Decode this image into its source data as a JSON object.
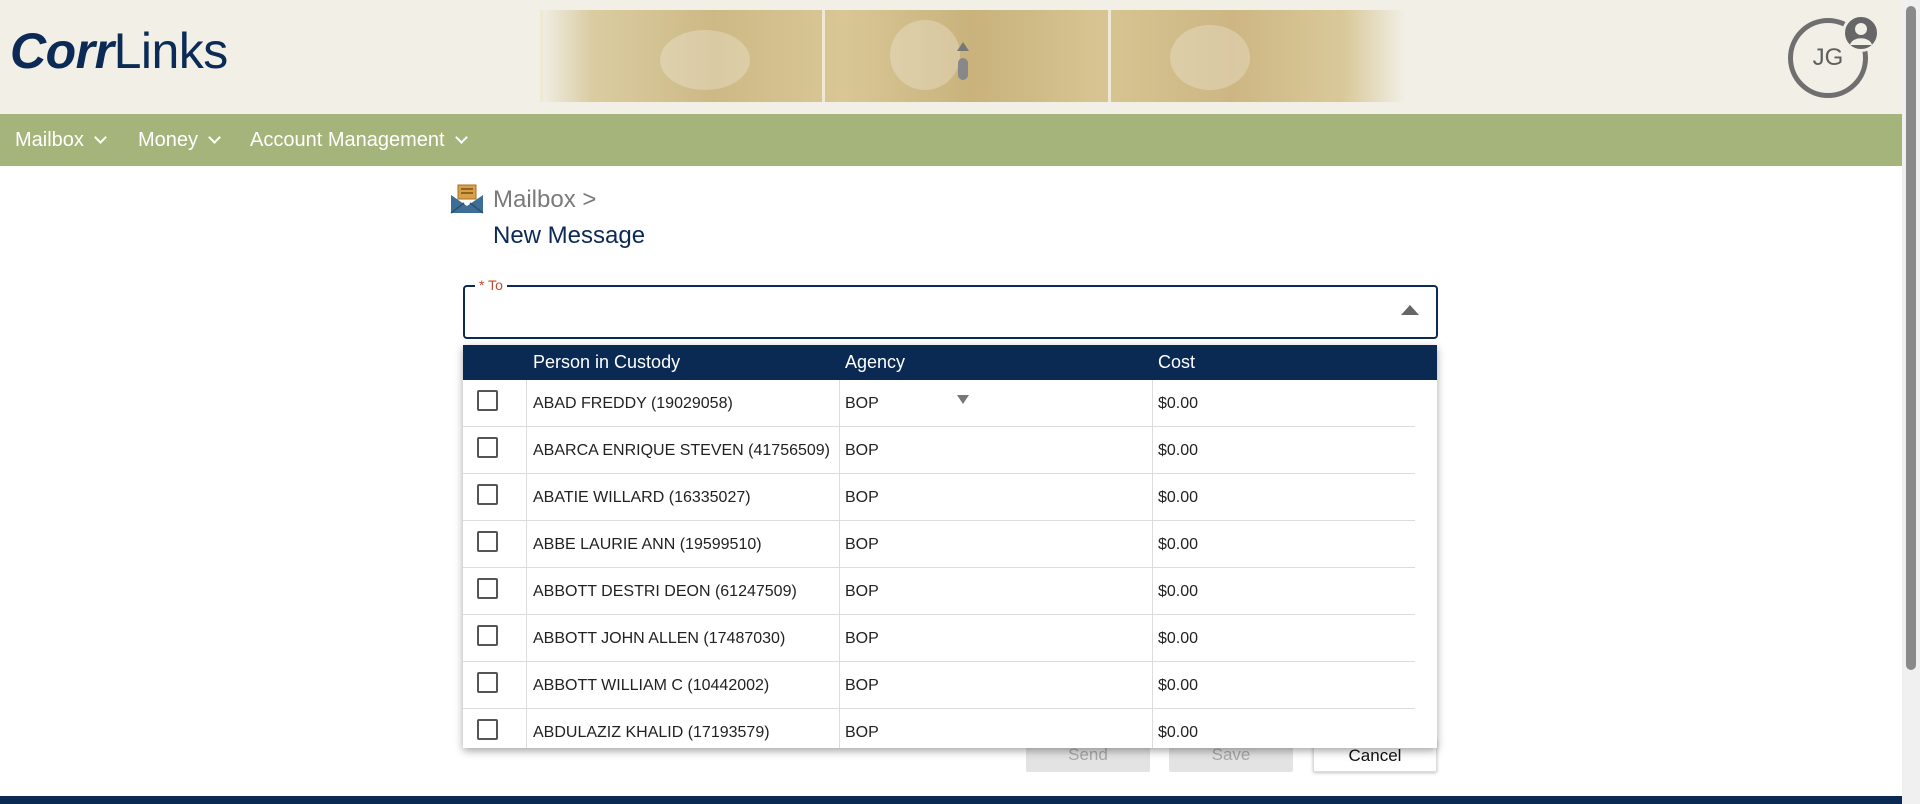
{
  "brand": {
    "logo_bold": "Corr",
    "logo_regular": "Links"
  },
  "user": {
    "initials": "JG"
  },
  "nav": {
    "items": [
      {
        "label": "Mailbox"
      },
      {
        "label": "Money"
      },
      {
        "label": "Account Management"
      }
    ]
  },
  "breadcrumb": {
    "parent": "Mailbox >",
    "title": "New Message"
  },
  "to_field": {
    "required_marker": "*",
    "label": "To"
  },
  "dropdown": {
    "columns": [
      "Person in Custody",
      "Agency",
      "Cost"
    ],
    "rows": [
      {
        "name": "ABAD FREDDY (19029058)",
        "agency": "BOP",
        "cost": "$0.00"
      },
      {
        "name": "ABARCA ENRIQUE STEVEN (41756509)",
        "agency": "BOP",
        "cost": "$0.00"
      },
      {
        "name": "ABATIE WILLARD (16335027)",
        "agency": "BOP",
        "cost": "$0.00"
      },
      {
        "name": "ABBE LAURIE ANN (19599510)",
        "agency": "BOP",
        "cost": "$0.00"
      },
      {
        "name": "ABBOTT DESTRI DEON (61247509)",
        "agency": "BOP",
        "cost": "$0.00"
      },
      {
        "name": "ABBOTT JOHN ALLEN (17487030)",
        "agency": "BOP",
        "cost": "$0.00"
      },
      {
        "name": "ABBOTT WILLIAM C (10442002)",
        "agency": "BOP",
        "cost": "$0.00"
      },
      {
        "name": "ABDULAZIZ KHALID (17193579)",
        "agency": "BOP",
        "cost": "$0.00"
      }
    ]
  },
  "actions": {
    "send": "Send",
    "save": "Save",
    "cancel": "Cancel"
  },
  "colors": {
    "navy": "#0a2a54",
    "nav_green": "#a5b47a",
    "header_bg": "#f1efe6",
    "required_red": "#c0492c"
  },
  "icons": {
    "mailbox": "open-envelope-icon",
    "avatar": "user-avatar-icon",
    "dropdown": "caret-up-icon"
  }
}
